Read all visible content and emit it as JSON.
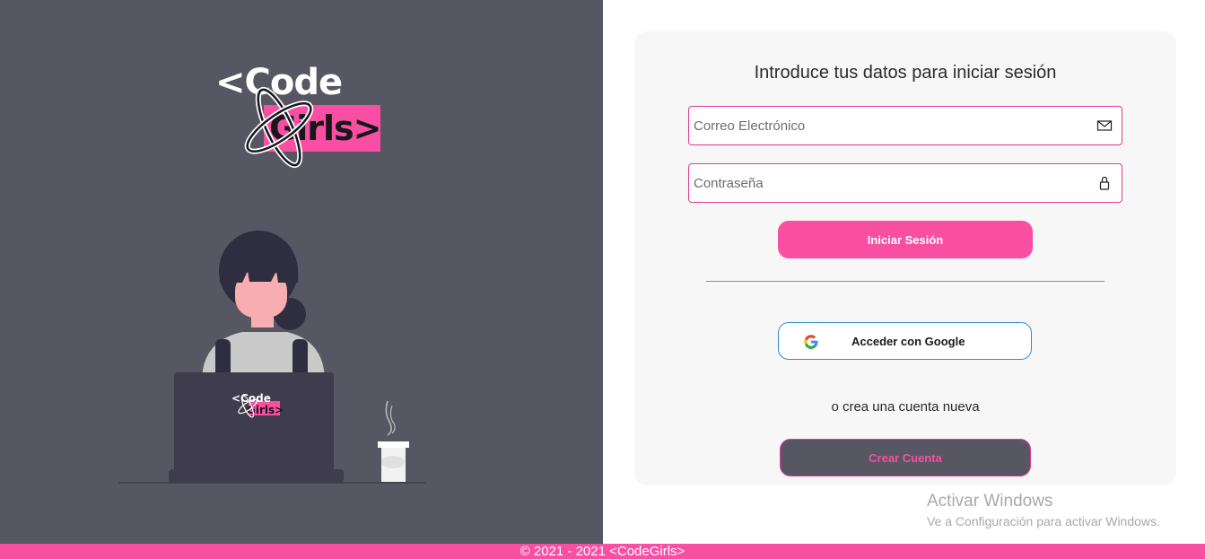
{
  "brand": {
    "logo_line1": "<Code",
    "logo_line2": "Girls>",
    "laptop_logo_line1": "<Code",
    "laptop_logo_line2": "Girls>",
    "colors": {
      "pink": "#f84fa3",
      "dark_panel": "#575663",
      "card_bg": "#f7f7f7"
    }
  },
  "login": {
    "title": "Introduce tus datos para iniciar sesión",
    "email_placeholder": "Correo Electrónico",
    "email_icon": "envelope-icon",
    "password_placeholder": "Contraseña",
    "password_icon": "lock-icon",
    "submit_label": "Iniciar Sesión",
    "google_label": "Acceder con Google",
    "google_icon": "google-g-icon",
    "signup_prompt": "o crea una cuenta nueva",
    "create_account_label": "Crear Cuenta"
  },
  "watermark": {
    "title": "Activar Windows",
    "subtitle": "Ve a Configuración para activar Windows."
  },
  "footer": {
    "text": "© 2021 - 2021 <CodeGirls>"
  }
}
